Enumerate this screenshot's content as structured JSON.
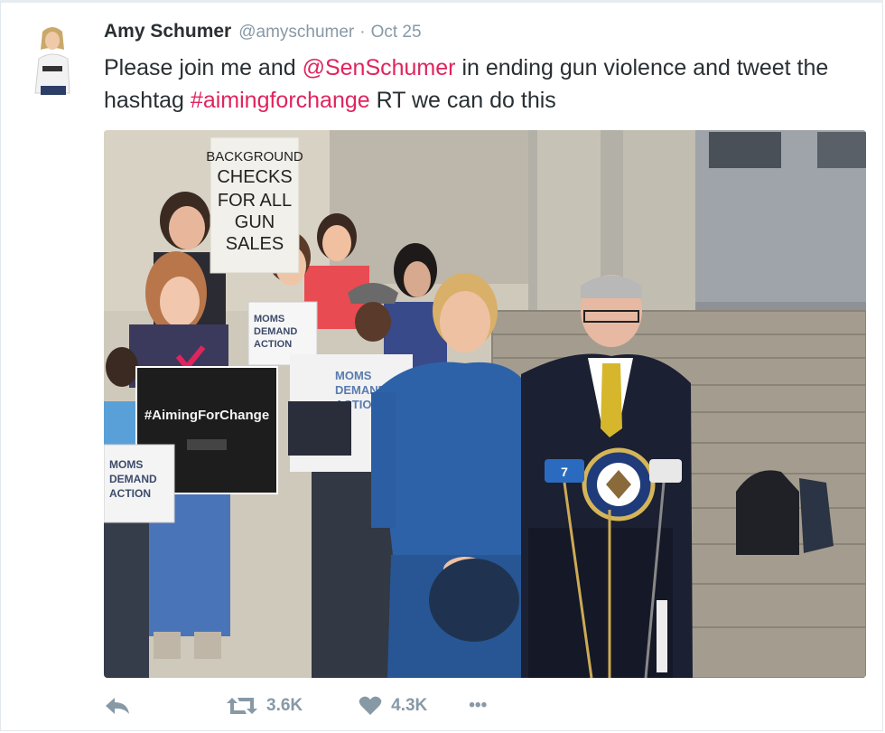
{
  "tweet": {
    "author": {
      "display_name": "Amy Schumer",
      "handle": "@amyschumer",
      "separator": "·",
      "timestamp": "Oct 25"
    },
    "text": {
      "part1": "Please join me and ",
      "mention": "@SenSchumer",
      "part2": " in ending gun violence and tweet the hashtag ",
      "hashtag": "#aimingforchange",
      "part3": " RT we can do this"
    },
    "media": {
      "sign_background_checks": [
        "BACKGROUND",
        "CHECKS",
        "FOR ALL",
        "GUN",
        "SALES"
      ],
      "sign_moms_1": [
        "MOMS",
        "DEMAND",
        "ACTION"
      ],
      "sign_aiming": "#AimingForChange",
      "sign_moms_2": [
        "MOMS",
        "DEMAND",
        "ACTION"
      ],
      "shirt_text": [
        "MOMS",
        "DEMAND",
        "ACTION"
      ]
    },
    "actions": {
      "retweet_count": "3.6K",
      "like_count": "4.3K",
      "more_label": "•••"
    }
  },
  "colors": {
    "link": "#e0245e",
    "muted": "#8899a6",
    "text": "#292f33"
  },
  "icons": [
    "reply-icon",
    "retweet-icon",
    "heart-icon",
    "more-icon"
  ]
}
